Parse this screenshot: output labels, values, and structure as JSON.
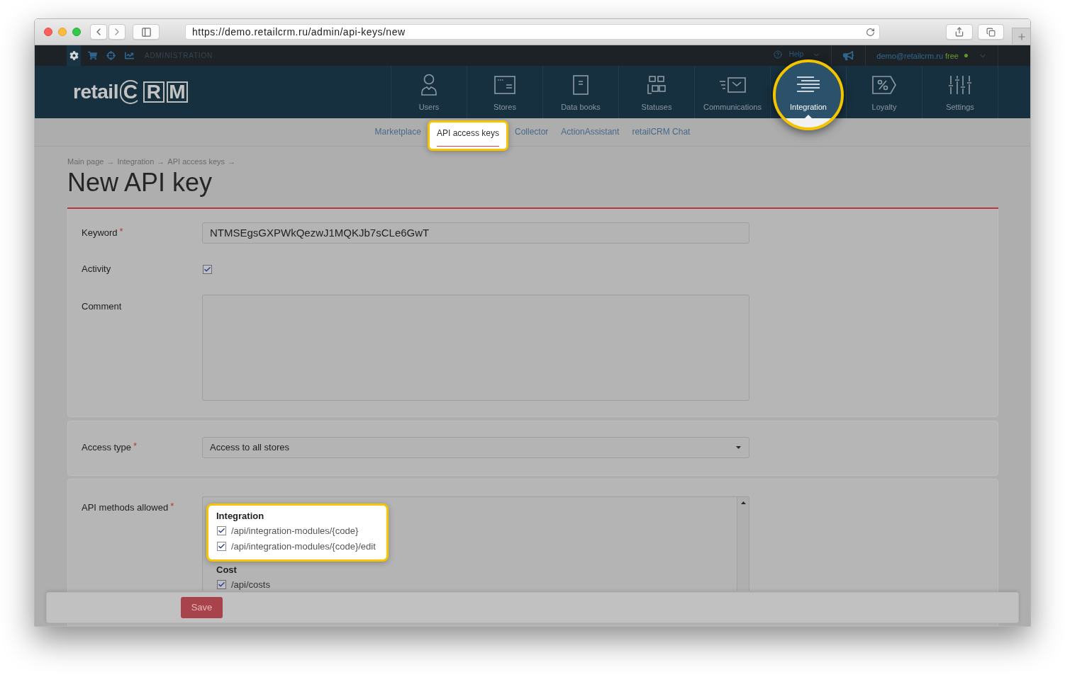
{
  "browser": {
    "url": "https://demo.retailcrm.ru/admin/api-keys/new"
  },
  "admin_bar": {
    "tools": [
      {
        "selected": true
      },
      {
        "selected": false
      },
      {
        "selected": false
      },
      {
        "selected": false
      }
    ],
    "section": "ADMINISTRATION",
    "help": "Help",
    "user_email": "demo@retailcrm.ru",
    "plan": "free"
  },
  "logo": {
    "word": "retail",
    "letters": [
      "C",
      "R",
      "M"
    ]
  },
  "nav": [
    {
      "label": "Users",
      "selected": false,
      "spotlight": false
    },
    {
      "label": "Stores",
      "selected": false,
      "spotlight": false
    },
    {
      "label": "Data books",
      "selected": false,
      "spotlight": false
    },
    {
      "label": "Statuses",
      "selected": false,
      "spotlight": false
    },
    {
      "label": "Communications",
      "selected": false,
      "spotlight": false
    },
    {
      "label": "Integration",
      "selected": true,
      "spotlight": true
    },
    {
      "label": "Loyalty",
      "selected": false,
      "spotlight": false
    },
    {
      "label": "Settings",
      "selected": false,
      "spotlight": false
    }
  ],
  "subnav": [
    {
      "label": "Marketplace",
      "selected": false,
      "spotlight": false
    },
    {
      "label": "API access keys",
      "selected": true,
      "spotlight": true
    },
    {
      "label": "Collector",
      "selected": false,
      "spotlight": false
    },
    {
      "label": "ActionAssistant",
      "selected": false,
      "spotlight": false
    },
    {
      "label": "retailCRM Chat",
      "selected": false,
      "spotlight": false
    }
  ],
  "breadcrumb": {
    "items": [
      "Main page",
      "Integration",
      "API access keys"
    ],
    "separator": "→"
  },
  "title": "New API key",
  "form": {
    "required_mark": "*",
    "keyword": {
      "label": "Keyword",
      "required": true,
      "value": "NTMSEgsGXPWkQezwJ1MQKJb7sCLe6GwT"
    },
    "activity": {
      "label": "Activity",
      "required": false,
      "checked": true
    },
    "comment": {
      "label": "Comment",
      "required": false
    },
    "access_type": {
      "label": "Access type",
      "required": true,
      "value": "Access to all stores"
    },
    "api_methods": {
      "label": "API methods allowed",
      "required": true,
      "groups": [
        {
          "name": "Integration",
          "spotlight": true,
          "methods": [
            {
              "path": "/api/integration-modules/{code}",
              "checked": true
            },
            {
              "path": "/api/integration-modules/{code}/edit",
              "checked": true
            }
          ]
        },
        {
          "name": "Cost",
          "spotlight": false,
          "methods": [
            {
              "path": "/api/costs",
              "checked": true
            }
          ]
        }
      ]
    }
  },
  "save_button": "Save"
}
